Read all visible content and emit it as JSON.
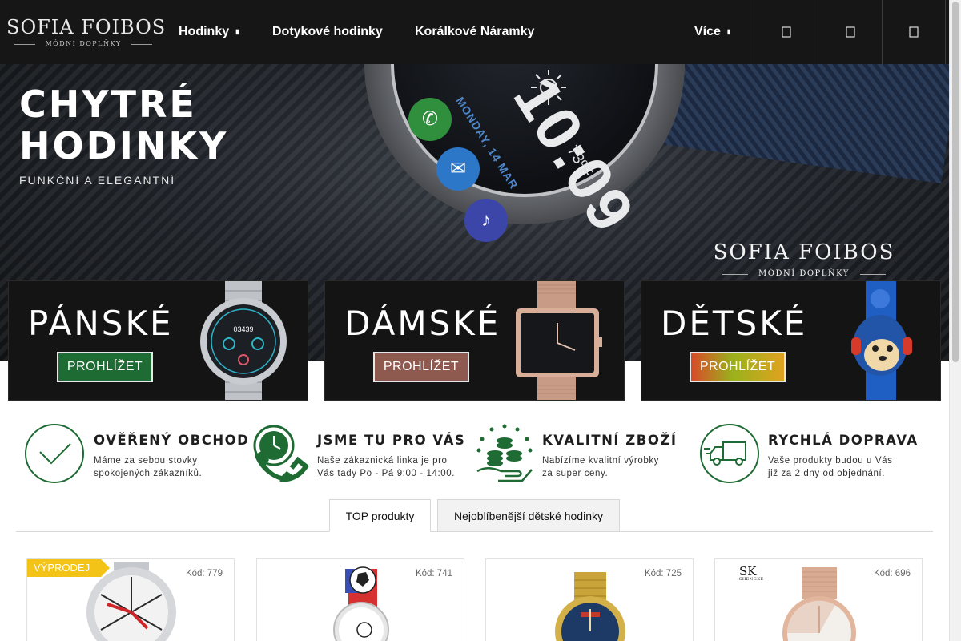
{
  "header": {
    "logo": {
      "name": "SOFIA FOIBOS",
      "tagline": "MÓDNÍ DOPLŇKY"
    },
    "nav": [
      {
        "label": "Hodinky",
        "caret": "▮"
      },
      {
        "label": "Dotykové hodinky"
      },
      {
        "label": "Korálkové Náramky"
      },
      {
        "label": "Více",
        "caret": "▮"
      }
    ],
    "icons": [
      "search-icon",
      "user-icon",
      "cart-icon"
    ]
  },
  "hero": {
    "title_line1": "CHYTRÉ",
    "title_line2": "HODINKY",
    "subtitle": "FUNKČNÍ A ELEGANTNÍ",
    "logo": {
      "name": "SOFIA FOIBOS",
      "tagline": "MÓDNÍ DOPLŇKY"
    },
    "watch": {
      "time": "10:09",
      "date": "MONDAY, 14 MAR",
      "temp": "73ºF"
    }
  },
  "categories": [
    {
      "title": "PÁNSKÉ",
      "button": "PROHLÍŽET",
      "button_color": "#1f6b34"
    },
    {
      "title": "DÁMSKÉ",
      "button": "PROHLÍŽET",
      "button_color": "#8e5a4f"
    },
    {
      "title": "DĚTSKÉ",
      "button": "PROHLÍŽET",
      "button_color": "#7aa51c"
    }
  ],
  "features": [
    {
      "title": "OVĚŘENÝ OBCHOD",
      "line1": "Máme za sebou stovky",
      "line2": "spokojených zákazníků."
    },
    {
      "title": "JSME TU PRO VÁS",
      "line1": "Naše zákaznická linka je pro",
      "line2": "Vás tady Po - Pá 9:00 - 14:00."
    },
    {
      "title": "KVALITNÍ ZBOŽÍ",
      "line1": "Nabízíme kvalitní výrobky",
      "line2": "za super ceny."
    },
    {
      "title": "RYCHLÁ DOPRAVA",
      "line1": "Vaše produkty budou u Vás",
      "line2": "již za 2 dny od objednání."
    }
  ],
  "tabs": [
    {
      "label": "TOP produkty",
      "active": true
    },
    {
      "label": "Nejoblíbenější dětské hodinky",
      "active": false
    }
  ],
  "products": [
    {
      "code": "Kód: 779",
      "badge": "VÝPRODEJ"
    },
    {
      "code": "Kód: 741"
    },
    {
      "code": "Kód: 725"
    },
    {
      "code": "Kód: 696",
      "brand": "SK",
      "brand_sub": "SHENGKE"
    }
  ],
  "colors": {
    "accent_green": "#1f6b34",
    "badge_yellow": "#f3c318",
    "header_bg": "#161616"
  }
}
